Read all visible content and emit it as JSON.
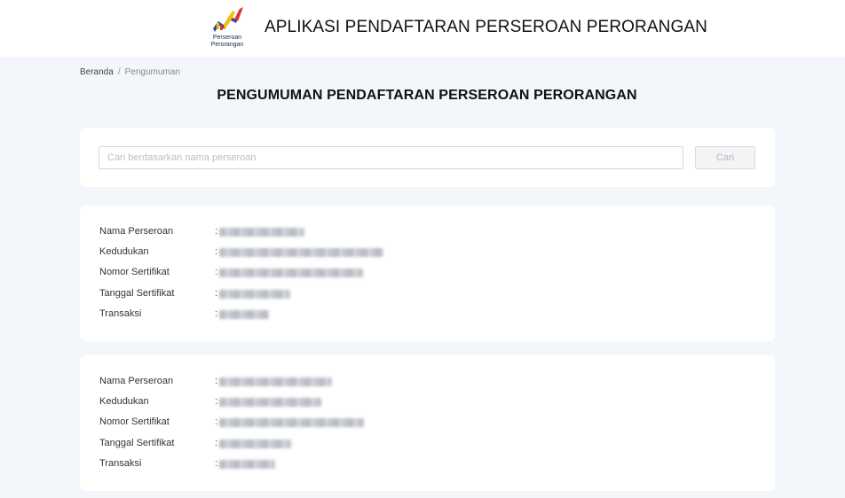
{
  "header": {
    "logo_text_line1": "Perseroan",
    "logo_text_line2": "Perorangan",
    "app_title": "APLIKASI PENDAFTARAN PERSEROAN PERORANGAN"
  },
  "breadcrumb": {
    "home": "Beranda",
    "separator": "/",
    "current": "Pengumuman"
  },
  "page_title": "PENGUMUMAN PENDAFTARAN PERSEROAN PERORANGAN",
  "search": {
    "placeholder": "Cari berdasarkan nama perseroan",
    "value": "",
    "button_label": "Cari"
  },
  "labels": {
    "name": "Nama Perseroan",
    "domicile": "Kedudukan",
    "certificate_number": "Nomor Sertifikat",
    "certificate_date": "Tanggal Sertifikat",
    "transaction": "Transaksi",
    "colon": ":"
  },
  "results": [
    {
      "name": "",
      "domicile": "",
      "certificate_number": "",
      "certificate_date": "",
      "transaction": ""
    },
    {
      "name": "",
      "domicile": "",
      "certificate_number": "",
      "certificate_date": "",
      "transaction": ""
    }
  ],
  "colors": {
    "page_background": "#f3f6fb",
    "card_background": "#ffffff",
    "logo_yellow": "#f5c400",
    "logo_red": "#e0342b",
    "logo_blue": "#2a4fa8"
  },
  "icons": {
    "logo": "perseroan-perorangan-logo"
  }
}
